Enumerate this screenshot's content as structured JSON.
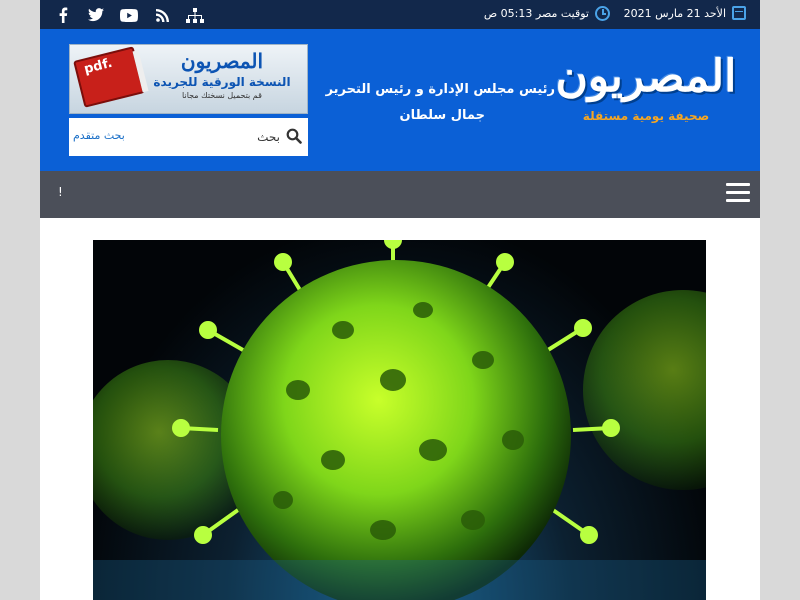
{
  "topbar": {
    "date": "الأحد 21 مارس 2021",
    "time": "توقيت مصر 05:13 ص",
    "social_icons": [
      "facebook-icon",
      "twitter-icon",
      "youtube-icon",
      "rss-icon",
      "sitemap-icon"
    ]
  },
  "header": {
    "logo_text": "المصريون",
    "logo_tagline": "صحيفة يومية مستقلة",
    "editor_line": "رئيس مجلس الإدارة و رئيس التحرير",
    "editor_name": "جمال سلطان",
    "pdf_banner": {
      "badge": "pdf.",
      "logo": "المصريون",
      "title": "النسخة الورقية للجريدة",
      "subtitle": "قم بتحميل نسختك مجانا"
    },
    "search": {
      "placeholder": "بحث",
      "advanced_label": "بحث متقدم"
    }
  },
  "nav": {
    "ticker_text": "!"
  },
  "colors": {
    "topbar": "#12284b",
    "header": "#0b60d6",
    "navbar": "#4b4f59",
    "accent": "#f5a623"
  }
}
